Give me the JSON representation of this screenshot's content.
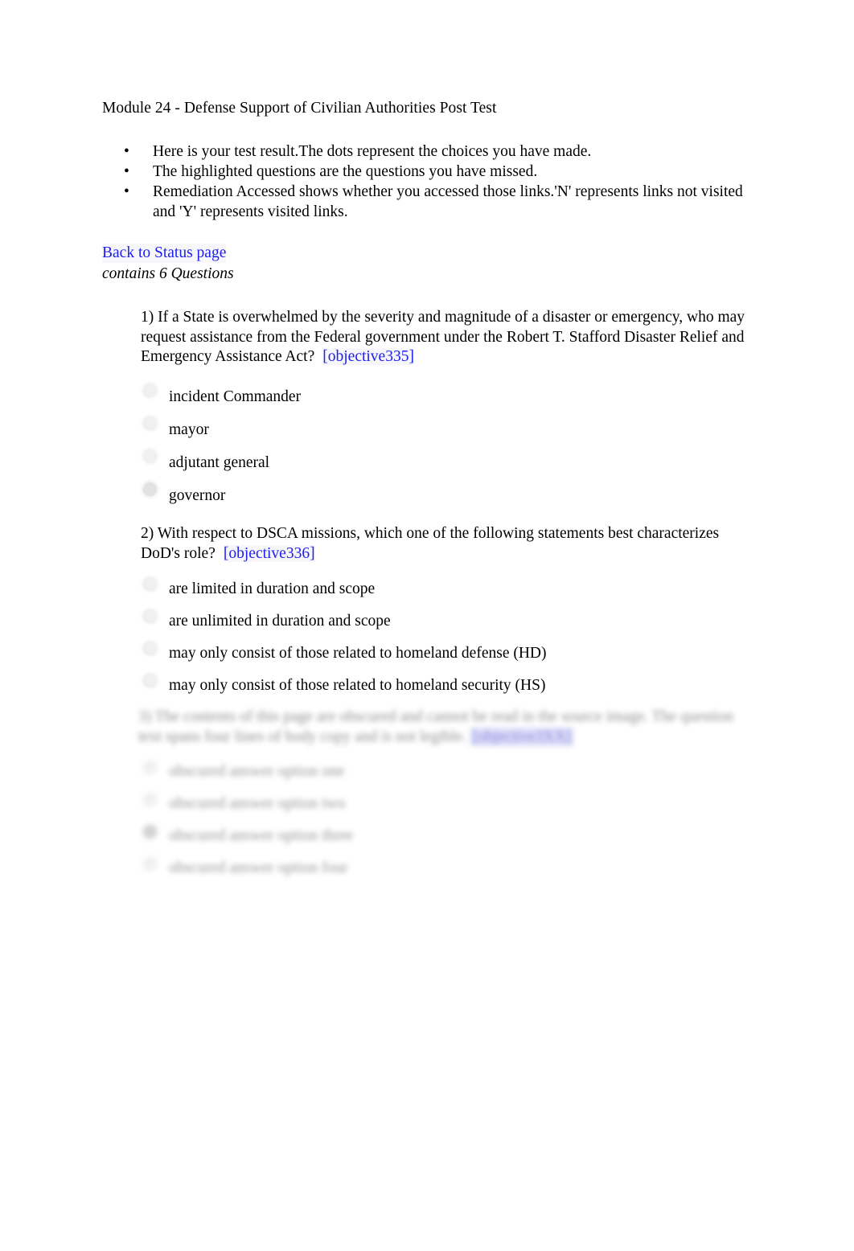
{
  "document": {
    "title": "Module 24 - Defense Support of Civilian Authorities Post Test",
    "contains_line": "contains 6 Questions",
    "back_link_label": "Back to Status page",
    "link_color": "#2020EE",
    "highlight_color": "#c9c9f3"
  },
  "intro": {
    "bullet_glyph": "•",
    "items": [
      "Here is your test result.The dots represent the choices you have made.",
      "The highlighted questions are the questions you have missed.",
      "Remediation Accessed shows whether you accessed those links.'N' represents links not visited and 'Y' represents visited links."
    ]
  },
  "questions": [
    {
      "number": "1)",
      "text": "1) If a State is overwhelmed by the severity and magnitude of a disaster or emergency, who may request assistance from the Federal government under the Robert T. Stafford Disaster Relief and Emergency Assistance Act?",
      "objective": "[objective335]",
      "answers": [
        {
          "label": "incident Commander",
          "selected": false
        },
        {
          "label": "mayor",
          "selected": false
        },
        {
          "label": "adjutant general",
          "selected": false
        },
        {
          "label": "governor",
          "selected": true
        }
      ]
    },
    {
      "number": "2)",
      "text": "2) With respect to DSCA missions, which one of the following statements best characterizes DoD's role?",
      "objective": "[objective336]",
      "answers": [
        {
          "label": "are limited in duration and scope",
          "selected": false
        },
        {
          "label": "are unlimited in duration and scope",
          "selected": false
        },
        {
          "label": "may only consist of those related to homeland defense (HD)",
          "selected": false
        },
        {
          "label": "may only consist of those related to homeland security (HS)",
          "selected": false
        }
      ]
    },
    {
      "number": "3)",
      "text": "3) The contents of this page are obscured and cannot be read in the source image. The question text spans four lines of body copy and is not legible.",
      "objective": "[objective3XX]",
      "answers": [
        {
          "label": "obscured answer option one",
          "selected": false
        },
        {
          "label": "obscured answer option two",
          "selected": false
        },
        {
          "label": "obscured answer option three",
          "selected": true
        },
        {
          "label": "obscured answer option four",
          "selected": false
        }
      ]
    }
  ]
}
